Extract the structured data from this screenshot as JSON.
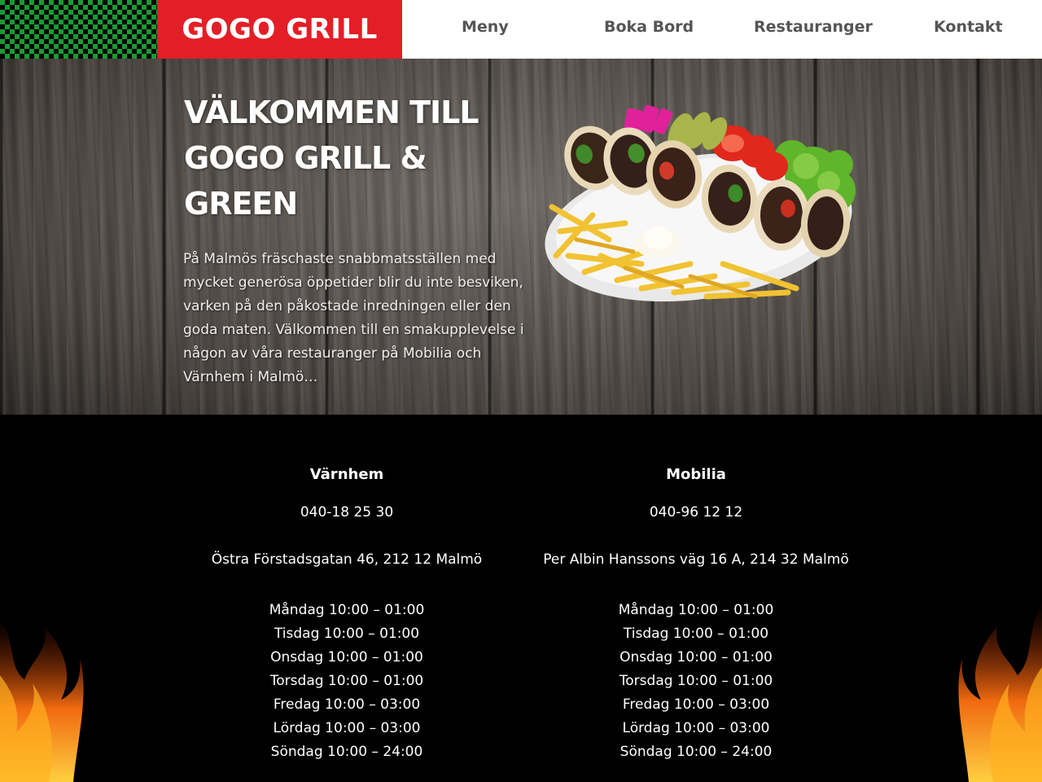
{
  "brand": {
    "logo_text": "GOGO GRILL"
  },
  "nav": {
    "items": [
      {
        "label": "Meny"
      },
      {
        "label": "Boka Bord"
      },
      {
        "label": "Restauranger"
      },
      {
        "label": "Kontakt"
      }
    ]
  },
  "hero": {
    "title": "VÄLKOMMEN TILL GOGO GRILL & GREEN",
    "text": "På Malmös fräschaste snabbmatsställen med mycket generösa öppetider blir du inte besviken, varken på den påkostade inredningen eller den goda maten. Välkommen till en smakupplevelse i någon av våra restauranger på Mobilia och Värnhem i Malmö…"
  },
  "locations": [
    {
      "name": "Värnhem",
      "phone": "040-18 25 30",
      "address": "Östra Förstadsgatan 46, 212 12 Malmö",
      "hours": [
        "Måndag 10:00 – 01:00",
        "Tisdag 10:00 – 01:00",
        "Onsdag 10:00 – 01:00",
        "Torsdag 10:00 – 01:00",
        "Fredag 10:00 – 03:00",
        "Lördag 10:00 – 03:00",
        "Söndag 10:00 – 24:00"
      ]
    },
    {
      "name": "Mobilia",
      "phone": "040-96 12 12",
      "address": "Per Albin Hanssons väg 16 A, 214 32 Malmö",
      "hours": [
        "Måndag 10:00 – 01:00",
        "Tisdag 10:00 – 01:00",
        "Onsdag 10:00 – 01:00",
        "Torsdag 10:00 – 01:00",
        "Fredag 10:00 – 03:00",
        "Lördag 10:00 – 03:00",
        "Söndag 10:00 – 24:00"
      ]
    }
  ],
  "colors": {
    "brand_red": "#e41e26",
    "checker_green": "#1a9a32",
    "nav_text": "#555555",
    "info_background": "#000000"
  },
  "icons": {
    "hero_image": "wrap-plate-image",
    "decor": "flame-decoration"
  }
}
